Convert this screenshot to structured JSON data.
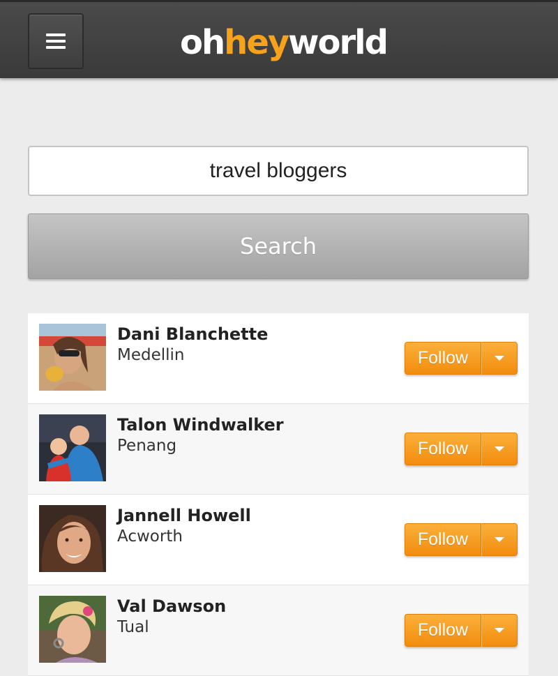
{
  "header": {
    "logo_part1": "oh",
    "logo_part2": "hey",
    "logo_part3": "world",
    "menu_icon": "hamburger-menu-icon"
  },
  "search": {
    "query": "travel bloggers",
    "button_label": "Search"
  },
  "results": [
    {
      "name": "Dani Blanchette",
      "location": "Medellin",
      "follow_label": "Follow"
    },
    {
      "name": "Talon Windwalker",
      "location": "Penang",
      "follow_label": "Follow"
    },
    {
      "name": "Jannell Howell",
      "location": "Acworth",
      "follow_label": "Follow"
    },
    {
      "name": "Val Dawson",
      "location": "Tual",
      "follow_label": "Follow"
    }
  ],
  "colors": {
    "accent": "#f7a21b",
    "follow_button": "#f5961f",
    "topbar": "#444444",
    "search_button": "#b5b5b5"
  }
}
